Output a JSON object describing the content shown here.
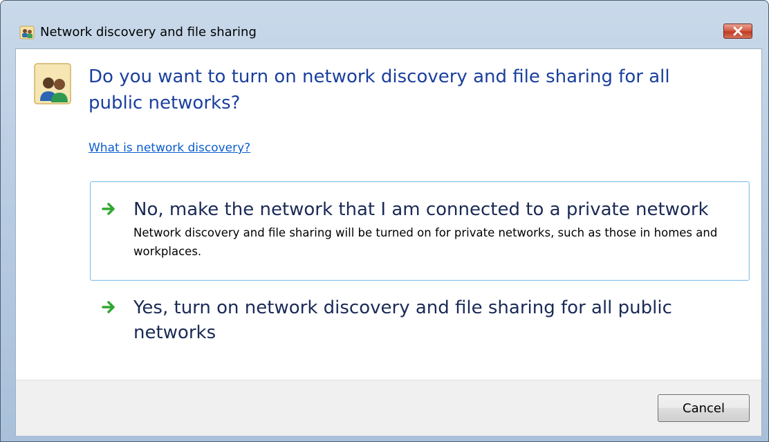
{
  "window": {
    "title": "Network discovery and file sharing",
    "title_icon": "network-users-icon",
    "close_icon": "close-icon"
  },
  "dialog": {
    "icon": "network-users-icon",
    "heading": "Do you want to turn on network discovery and file sharing for all public networks?",
    "help_link": "What is network discovery?",
    "options": [
      {
        "icon": "green-arrow-icon",
        "title": "No, make the network that I am connected to a private network",
        "description": "Network discovery and file sharing will be turned on for private networks, such as those in homes and workplaces."
      },
      {
        "icon": "green-arrow-icon",
        "title": "Yes, turn on network discovery and file sharing for all public networks",
        "description": ""
      }
    ]
  },
  "footer": {
    "cancel_label": "Cancel"
  },
  "colors": {
    "heading": "#1a3f9e",
    "link": "#0a5ccf",
    "option_border": "#86c4ee",
    "arrow": "#2ea82e",
    "close_button": "#c03b22"
  }
}
